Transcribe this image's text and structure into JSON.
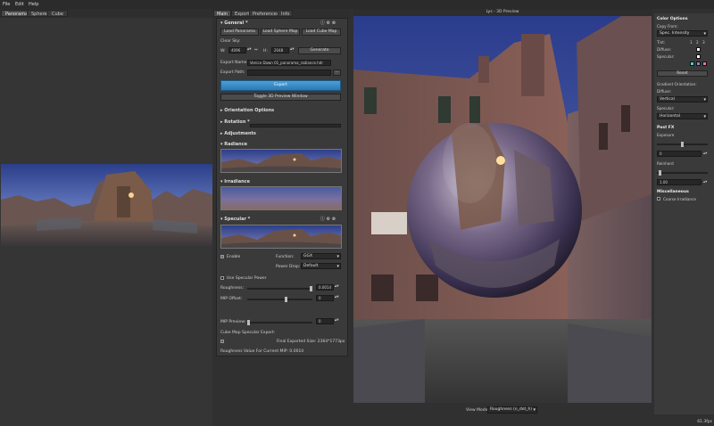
{
  "menu": {
    "file": "File",
    "edit": "Edit",
    "help": "Help"
  },
  "left_tabs": [
    "Panorama",
    "Sphere",
    "Cube"
  ],
  "mid_tabs": [
    "Main",
    "Export",
    "Preferences",
    "Info"
  ],
  "general": {
    "title": "General *",
    "load_panorama": "Load Panorama",
    "load_sphere_map": "Load Sphere Map",
    "load_cube_map": "Load Cube Map",
    "clear_sky": "Clear Sky:",
    "w_label": "W:",
    "w_value": "4096",
    "h_label": "H:",
    "h_value": "2048",
    "generate": "Generate",
    "export_name_label": "Export Name:",
    "export_name_value": "Venice Dawn 01_panorama_radiance.hdr",
    "export_path_label": "Export Path:",
    "browse": "...",
    "export_button": "Export",
    "toggle_preview": "Toggle 3D Preview Window"
  },
  "sections": {
    "orientation": "Orientation Options",
    "rotation": "Rotation *",
    "adjustments": "Adjustments",
    "radiance": "Radiance",
    "irradiance": "Irradiance",
    "specular": "Specular *"
  },
  "specular": {
    "enable": "Enable",
    "function_label": "Function:",
    "function_value": "GGX",
    "power_drop_label": "Power Drop:",
    "power_drop_value": "Default",
    "use_specular_power": "Use Specular Power",
    "roughness_label": "Roughness:",
    "roughness_value": "0.0014",
    "mip_offset_label": "MIP Offset:",
    "mip_offset_value": "0",
    "mip_preview_label": "MIP Preview:",
    "mip_preview_value": "0",
    "cube_export_label": "Cube Map Specular Export:",
    "final_size": "Final Exported Size: 2364*1773px",
    "roughness_current": "Roughness Value For Current MIP: 0.0014"
  },
  "viewer": {
    "title": "Lys - 3D Preview",
    "view_mode_label": "View Mode:",
    "view_mode_value": "Roughness (n_dot_h)"
  },
  "right": {
    "color_options": "Color Options",
    "copy_from": "Copy From:",
    "copy_from_value": "Spec. Intensity",
    "tint": "Tint:",
    "tint_nums": [
      "1",
      "2",
      "3"
    ],
    "diffuse": "Diffuse:",
    "specular": "Specular:",
    "reset": "Reset",
    "gradient_orientation": "Gradient Orientation:",
    "diffuse2": "Diffuse:",
    "diffuse_dir": "Vertical",
    "specular2": "Specular:",
    "specular_dir": "Horizontal",
    "post_fx": "Post FX",
    "exposure": "Exposure",
    "exposure_value": "0",
    "reinhard": "Reinhard",
    "reinhard_value": "1.00",
    "misc": "Miscellaneous",
    "coarse_irradiance": "Coarse Irradiance",
    "fps": "61.3fps"
  },
  "colors": {
    "accent": "#3c8ec8",
    "panel": "#3a3a3a",
    "bg": "#303030"
  }
}
